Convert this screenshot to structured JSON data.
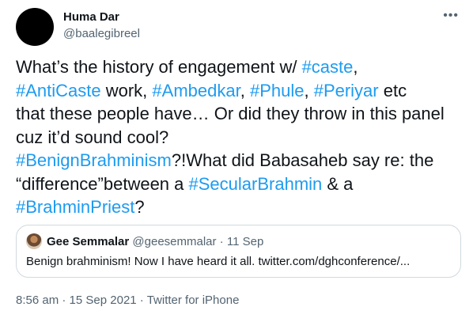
{
  "tweet": {
    "author": {
      "display_name": "Huma Dar",
      "handle": "@baalegibreel"
    },
    "more_icon": "more-horizontal-icon",
    "lines": {
      "l1_a": "What’s the history of engagement w/ ",
      "l1_tag1": "#caste",
      "l1_b": ",",
      "l2_tag1": "#AntiCaste",
      "l2_a": " work, ",
      "l2_tag2": "#Ambedkar",
      "l2_b": ", ",
      "l2_tag3": "#Phule",
      "l2_c": ", ",
      "l2_tag4": "#Periyar",
      "l2_d": " etc",
      "l3": "that these people have… Or did they throw in this panel",
      "l4": "cuz it’d sound cool?",
      "l5_tag": "#BenignBrahminism",
      "l5_a": "?!What did Babasaheb say re: the",
      "l6_a": "“difference”between a ",
      "l6_tag": "#SecularBrahmin",
      "l6_b": " & a",
      "l7_tag": "#BrahminPriest",
      "l7_a": "?"
    },
    "quote": {
      "name": "Gee Semmalar",
      "handle": "@geesemmalar",
      "separator": " · ",
      "date": "11 Sep",
      "text": "Benign brahminism! Now I have heard it all. twitter.com/dghconference/..."
    },
    "meta": {
      "time": "8:56 am",
      "separator1": " · ",
      "date": "15 Sep 2021",
      "separator2": " · ",
      "source": "Twitter for iPhone"
    }
  },
  "colors": {
    "link": "#1d9bf0",
    "text": "#0f1419",
    "secondary": "#536471",
    "border": "#cfd9de"
  }
}
